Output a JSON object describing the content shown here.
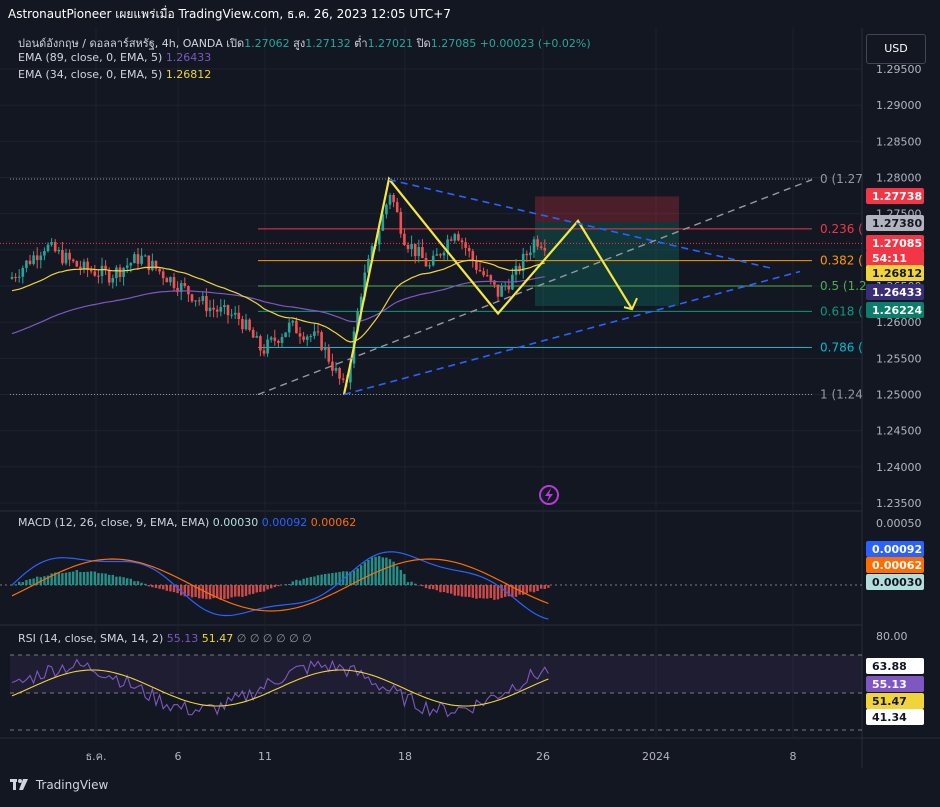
{
  "header": "AstronautPioneer เผยแพร่เมื่อ TradingView.com, ธ.ค. 26, 2023 12:05 UTC+7",
  "currency_button": "USD",
  "main_legend": {
    "symbol": "ปอนด์อังกฤษ / ดอลลาร์สหรัฐ, 4h, OANDA",
    "open_label": "เปิด",
    "open": "1.27062",
    "high_label": "สูง",
    "high": "1.27132",
    "low_label": "ต่ำ",
    "low": "1.27021",
    "close_label": "ปิด",
    "close": "1.27085",
    "change": "+0.00023 (+0.02%)",
    "ema89": "EMA (89, close, 0, EMA, 5)",
    "ema89_value": "1.26433",
    "ema34": "EMA (34, close, 0, EMA, 5)",
    "ema34_value": "1.26812"
  },
  "macd_legend": {
    "label": "MACD (12, 26, close, 9, EMA, EMA)",
    "hist": "0.00030",
    "macd": "0.00092",
    "signal": "0.00062"
  },
  "rsi_legend": {
    "label": "RSI (14, close, SMA, 14, 2)",
    "rsi": "55.13",
    "ma": "51.47",
    "extra": "∅ ∅ ∅ ∅ ∅ ∅"
  },
  "colors": {
    "background": "#131722",
    "up": "#26a69a",
    "down": "#ef5350",
    "ema34": "#f0d43a",
    "ema89": "#7e57c2",
    "pattern": "#f5e642",
    "trend_dash": "#2962ff",
    "macd": "#2962ff",
    "signal": "#ff6d00",
    "rsi": "#7e57c2",
    "rsi_ma": "#f0d43a"
  },
  "price_axis": [
    "1.29500",
    "1.29000",
    "1.28500",
    "1.28000",
    "1.27500",
    "1.27000",
    "1.26500",
    "1.26000",
    "1.25500",
    "1.25000",
    "1.24500",
    "1.24000",
    "1.23500"
  ],
  "price_tags": [
    {
      "text": "1.27738",
      "bg": "#f23645",
      "fg": "#ffffff"
    },
    {
      "text": "1.27380",
      "bg": "#b2b5be",
      "fg": "#131722"
    },
    {
      "text": "1.27085",
      "bg": "#f23645",
      "fg": "#ffffff"
    },
    {
      "text": "54:11",
      "bg": "#f23645",
      "fg": "#ffffff"
    },
    {
      "text": "1.26812",
      "bg": "#f0d43a",
      "fg": "#131722"
    },
    {
      "text": "1.26433",
      "bg": "#3a2d78",
      "fg": "#ffffff"
    },
    {
      "text": "1.26224",
      "bg": "#0b7d6b",
      "fg": "#ffffff"
    }
  ],
  "fib_levels": [
    {
      "label": "0 (1.27",
      "color": "#9598a1"
    },
    {
      "label": "0.236 (",
      "color": "#f23645"
    },
    {
      "label": "0.382 (",
      "color": "#ff9800"
    },
    {
      "label": "0.5 (1.2",
      "color": "#4caf50"
    },
    {
      "label": "0.618 (",
      "color": "#089981"
    },
    {
      "label": "0.786 (",
      "color": "#00bcd4"
    },
    {
      "label": "1 (1.24",
      "color": "#9598a1"
    }
  ],
  "macd_axis": "0.00050",
  "macd_tags": [
    {
      "text": "0.00092",
      "bg": "#2962ff",
      "fg": "#ffffff"
    },
    {
      "text": "0.00062",
      "bg": "#ff6d00",
      "fg": "#ffffff"
    },
    {
      "text": "0.00030",
      "bg": "#b2dfdb",
      "fg": "#131722"
    }
  ],
  "rsi_axis": "80.00",
  "rsi_tags": [
    {
      "text": "63.88",
      "bg": "#ffffff",
      "fg": "#131722"
    },
    {
      "text": "55.13",
      "bg": "#7e57c2",
      "fg": "#ffffff"
    },
    {
      "text": "51.47",
      "bg": "#f0d43a",
      "fg": "#131722"
    },
    {
      "text": "41.34",
      "bg": "#ffffff",
      "fg": "#131722"
    }
  ],
  "time_axis": [
    "ธ.ค.",
    "6",
    "11",
    "18",
    "26",
    "2024",
    "8"
  ],
  "footer": "TradingView",
  "chart_data": {
    "type": "candlestick",
    "title": "ปอนด์อังกฤษ / ดอลลาร์สหรัฐ, 4h, OANDA",
    "ylim": [
      1.233,
      1.298
    ],
    "fib_retracement": [
      {
        "ratio": "0",
        "price": 1.2798
      },
      {
        "ratio": "0.236",
        "price": 1.2729
      },
      {
        "ratio": "0.382",
        "price": 1.2685
      },
      {
        "ratio": "0.5",
        "price": 1.265
      },
      {
        "ratio": "0.618",
        "price": 1.2615
      },
      {
        "ratio": "0.786",
        "price": 1.2565
      },
      {
        "ratio": "1",
        "price": 1.25
      }
    ],
    "position_tool": {
      "stop": 1.27738,
      "entry": 1.2738,
      "target": 1.26224
    },
    "last_price": 1.27085,
    "ema34": 1.26812,
    "ema89": 1.26433,
    "macd": {
      "hist": 0.0003,
      "macd": 0.00092,
      "signal": 0.00062
    },
    "rsi": {
      "rsi": 55.13,
      "ma": 51.47,
      "upper_band": 63.88,
      "lower_band": 41.34
    }
  }
}
